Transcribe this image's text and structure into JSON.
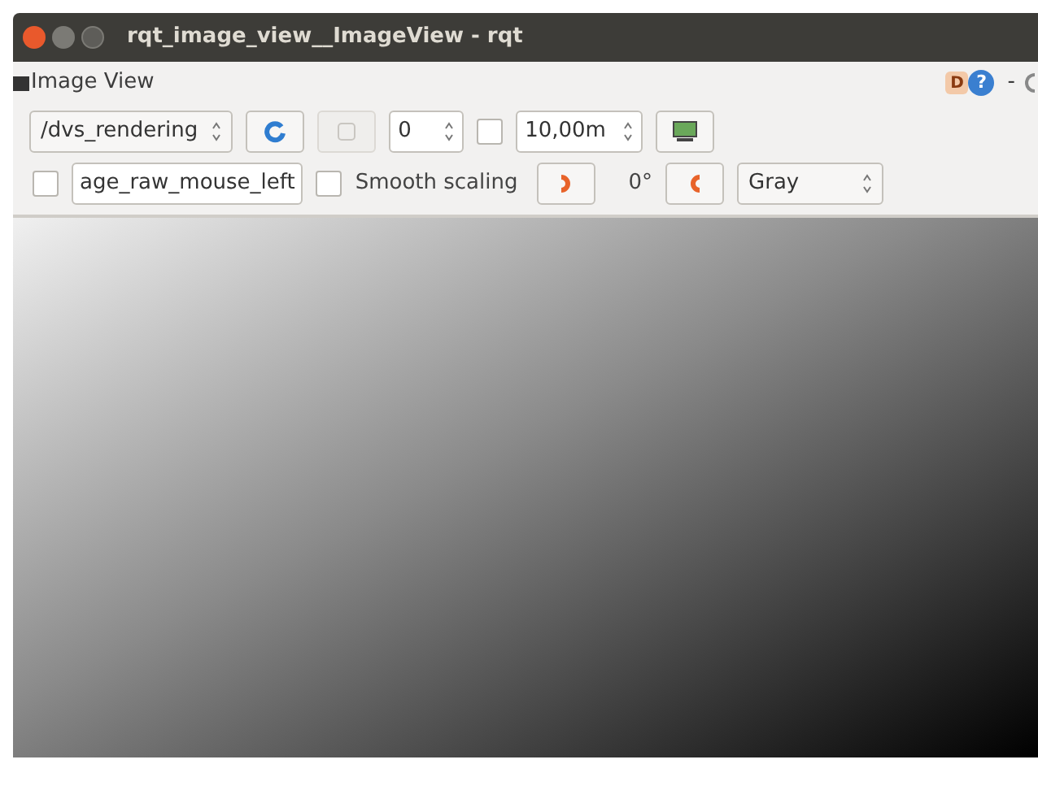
{
  "window": {
    "title": "rqt_image_view__ImageView - rqt"
  },
  "plugin": {
    "title": "Image View",
    "help_d": "D",
    "help": "?",
    "dash": "-"
  },
  "toolbar": {
    "topic": "/dvs_rendering",
    "number": "0",
    "smooth_enabled": false,
    "duration": "10,00m"
  },
  "toolbar2": {
    "mouse_checked": false,
    "mouse_topic": "age_raw_mouse_left",
    "smooth": {
      "label": "Smooth scaling",
      "checked": false
    },
    "rotation": "0°",
    "color_scheme": "Gray"
  }
}
